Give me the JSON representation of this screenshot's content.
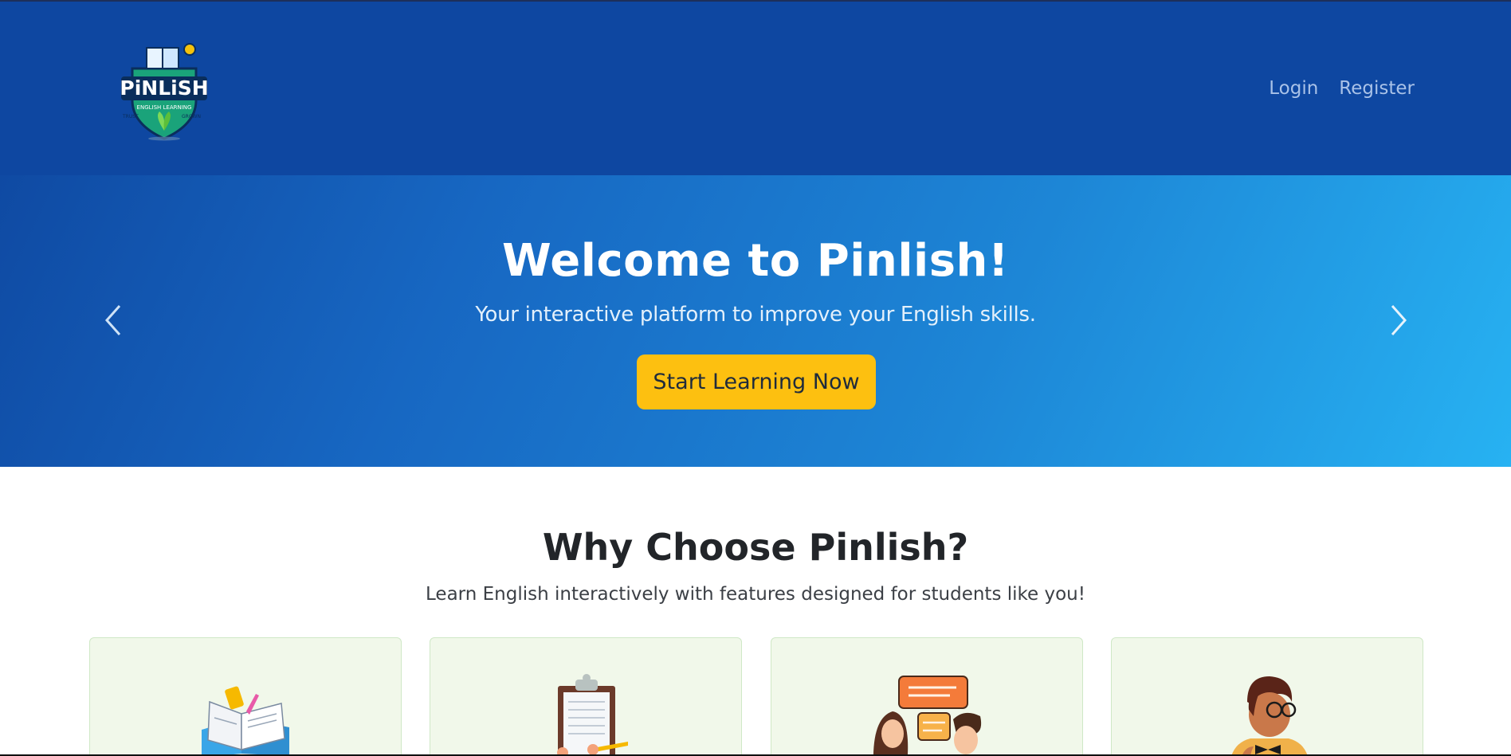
{
  "nav": {
    "logo_text": "PiNLiSH",
    "logo_tagline": "ENGLISH LEARNING",
    "logo_left_word": "TRUST",
    "logo_right_word": "GROWN",
    "links": [
      {
        "label": "Login"
      },
      {
        "label": "Register"
      }
    ]
  },
  "hero": {
    "title": "Welcome to Pinlish!",
    "subtitle": "Your interactive platform to improve your English skills.",
    "cta_label": "Start Learning Now",
    "prev_icon": "chevron-left-icon",
    "next_icon": "chevron-right-icon"
  },
  "features": {
    "title": "Why Choose Pinlish?",
    "subtitle": "Learn English interactively with features designed for students like you!",
    "cards": [
      {
        "icon": "open-book-icon"
      },
      {
        "icon": "clipboard-icon"
      },
      {
        "icon": "conversation-icon"
      },
      {
        "icon": "student-icon"
      }
    ]
  },
  "colors": {
    "navbar_bg": "#0e47a1",
    "hero_start": "#0f4aa3",
    "hero_end": "#27b2f2",
    "cta_bg": "#fdc010",
    "card_bg": "#f1f8ea"
  }
}
